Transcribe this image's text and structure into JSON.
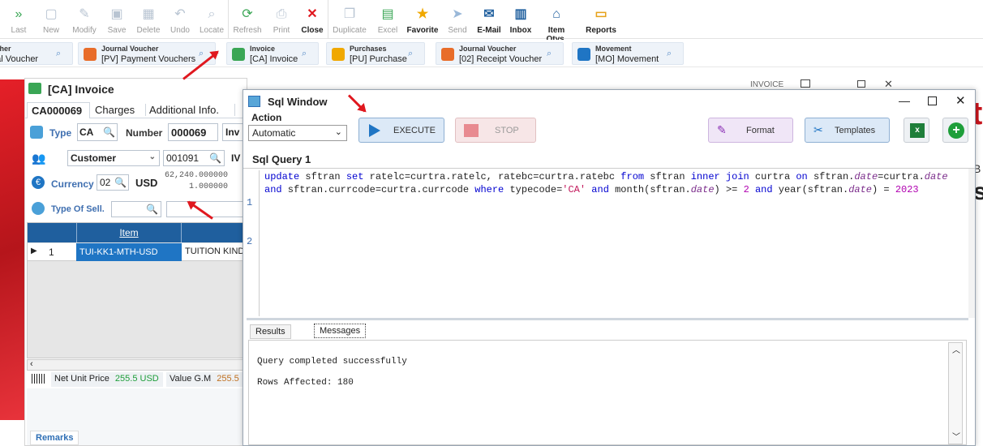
{
  "toolbar": {
    "items": [
      {
        "label": "Last",
        "icon": "double-chevron-right-icon",
        "active": false
      },
      {
        "label": "New",
        "icon": "new-doc-icon",
        "active": false
      },
      {
        "label": "Modify",
        "icon": "edit-icon",
        "active": false
      },
      {
        "label": "Save",
        "icon": "floppy-icon",
        "active": false
      },
      {
        "label": "Delete",
        "icon": "delete-icon",
        "active": false
      },
      {
        "label": "Undo",
        "icon": "undo-icon",
        "active": false
      },
      {
        "label": "Locate",
        "icon": "search-icon",
        "active": false
      },
      {
        "label": "Refresh",
        "icon": "refresh-icon",
        "active": false
      },
      {
        "label": "Print",
        "icon": "print-icon",
        "active": false
      },
      {
        "label": "Close",
        "icon": "close-icon",
        "active": true
      },
      {
        "label": "Duplicate",
        "icon": "duplicate-icon",
        "active": false
      },
      {
        "label": "Excel",
        "icon": "excel-icon",
        "active": false
      },
      {
        "label": "Favorite",
        "icon": "star-icon",
        "active": true
      },
      {
        "label": "Send",
        "icon": "send-icon",
        "active": false
      },
      {
        "label": "E-Mail",
        "icon": "email-icon",
        "active": true
      },
      {
        "label": "Inbox",
        "icon": "inbox-icon",
        "active": true
      },
      {
        "label": "Item Qtys.",
        "icon": "warehouse-icon",
        "active": true
      },
      {
        "label": "Reports",
        "icon": "folder-icon",
        "active": true
      }
    ]
  },
  "doc_tabs": [
    {
      "title": "ucher",
      "sub": "nal Voucher"
    },
    {
      "title": "Journal Voucher",
      "sub": "[PV] Payment Vouchers"
    },
    {
      "title": "Invoice",
      "sub": "[CA] Invoice"
    },
    {
      "title": "Purchases",
      "sub": "[PU] Purchase"
    },
    {
      "title": "Journal Voucher",
      "sub": "[02] Receipt Voucher"
    },
    {
      "title": "Movement",
      "sub": "[MO] Movement"
    }
  ],
  "invoice": {
    "title": "[CA] Invoice",
    "tabs": [
      "CA000069",
      "Charges",
      "Additional Info."
    ],
    "type_label": "Type",
    "type_value": "CA",
    "number_label": "Number",
    "number_value": "000069",
    "number_suffix": "Inv",
    "customer_label": "Customer",
    "customer_code": "001091",
    "customer_suffix": "IV",
    "currency_label": "Currency",
    "currency_code": "02",
    "currency_name": "USD",
    "rate1": "62,240.000000",
    "rate2": "1.000000",
    "type_of_sell_label": "Type Of Sell.",
    "grid_header": "Item",
    "grid_rows": [
      {
        "num": "1",
        "item": "TUI-KK1-MTH-USD",
        "desc": "TUITION KIND"
      }
    ],
    "net_unit_price_label": "Net Unit Price",
    "net_unit_price_value": "255.5 USD",
    "value_gm_label": "Value G.M",
    "value_gm_value": "255.5",
    "remarks_label": "Remarks",
    "bg_text": "INVOICE"
  },
  "sql_window": {
    "title": "Sql Window",
    "action_label": "Action",
    "action_value": "Automatic",
    "execute_label": "EXECUTE",
    "stop_label": "STOP",
    "format_label": "Format",
    "templates_label": "Templates",
    "query_tab": "Sql Query 1",
    "line_numbers": [
      "1",
      "2"
    ],
    "result_tabs": [
      "Results",
      "Messages"
    ],
    "messages": [
      "Query completed successfully",
      "Rows Affected: 180"
    ]
  },
  "colors": {
    "accent": "#2f6fb5",
    "red": "#e0181f",
    "green": "#1e9e3a"
  }
}
